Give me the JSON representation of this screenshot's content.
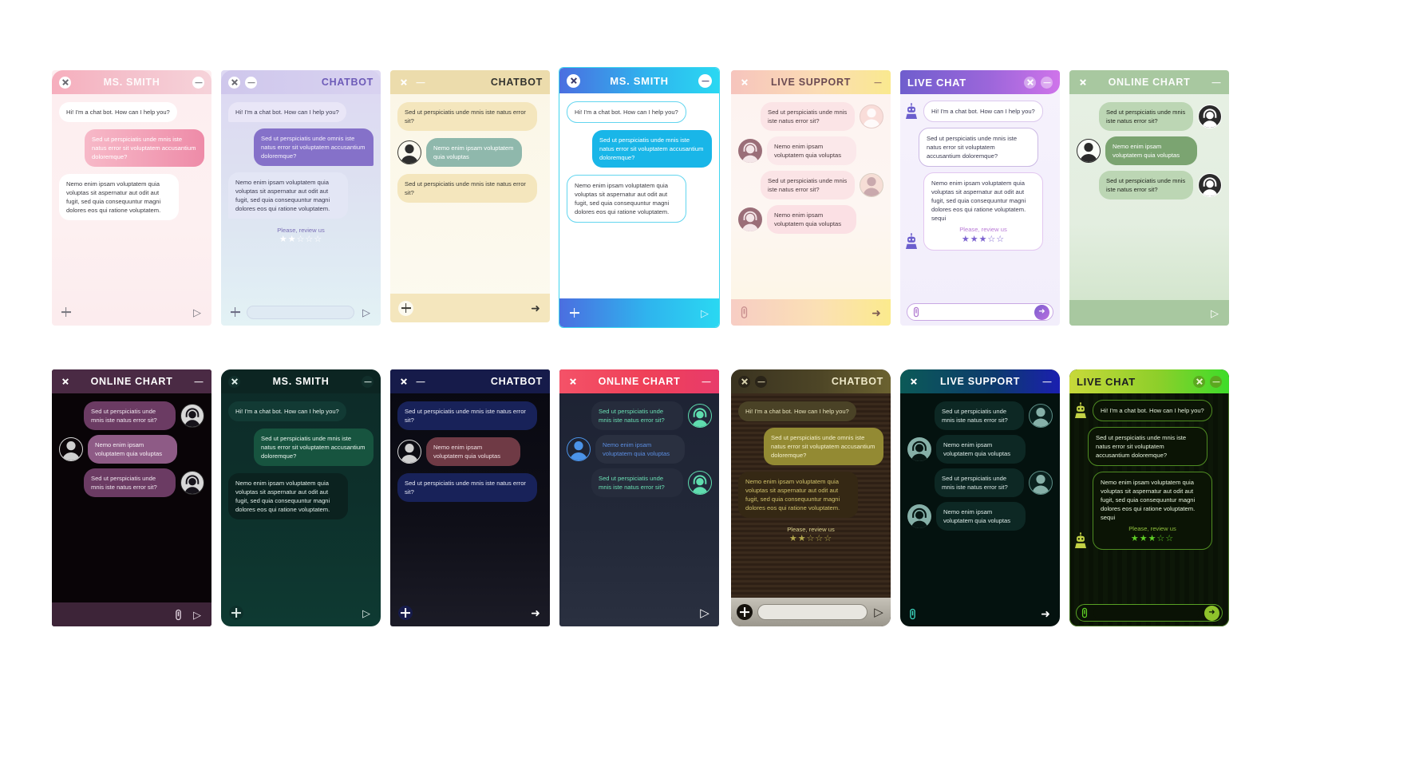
{
  "strings": {
    "greeting": "Hi! I'm a chat bot. How can I help you?",
    "q_long": "Sed ut perspiciatis unde mnis iste natus error sit voluptatem accusantium doloremque?",
    "q_long_omnis": "Sed ut perspiciatis unde omnis iste natus error sit voluptatem accusantium doloremque?",
    "answer_long": "Nemo enim ipsam voluptatem quia voluptas sit aspernatur aut odit aut fugit, sed quia consequuntur magni dolores eos qui ratione voluptatem.",
    "answer_long_sequi": "Nemo enim ipsam voluptatem quia voluptas sit aspernatur aut odit aut fugit, sed quia consequuntur magni dolores eos qui ratione voluptatem. sequi",
    "q_short": "Sed ut perspiciatis unde mnis iste natus error sit?",
    "answer_short": "Nemo enim ipsam voluptatem quia voluptas",
    "review": "Please, review us",
    "stars_2": "★★☆☆☆",
    "stars_3": "★★★☆☆"
  },
  "icons": {
    "close": "close-icon",
    "minimize": "minimize-icon",
    "send": "send-icon",
    "attach": "paperclip-icon",
    "plus": "plus-icon",
    "avatar": "avatar-icon",
    "headset": "headset-avatar-icon",
    "bot": "robot-icon"
  },
  "cards": [
    {
      "id": "card-1",
      "title": "MS. SMITH",
      "titleColor": "#ffffff",
      "theme": "pink-light",
      "messages": [
        {
          "side": "left",
          "text": "Hi! I'm a chat bot. How can I help you?"
        },
        {
          "side": "right",
          "text": "Sed ut perspiciatis unde mnis iste natus error sit voluptatem accusantium doloremque?"
        },
        {
          "side": "left",
          "text": "Nemo enim ipsam voluptatem quia voluptas sit aspernatur aut odit aut fugit, sed quia consequuntur magni dolores eos qui ratione voluptatem."
        }
      ],
      "footer": {
        "plus": true,
        "send": "triangle",
        "input": false
      }
    },
    {
      "id": "card-2",
      "title": "CHATBOT",
      "titleColor": "#6d5bb8",
      "theme": "lavender",
      "messages": [
        {
          "side": "left",
          "text": "Hi! I'm a chat bot. How can I help you?"
        },
        {
          "side": "right",
          "text": "Sed ut perspiciatis unde omnis iste natus error sit voluptatem accusantium doloremque?"
        },
        {
          "side": "left",
          "text": "Nemo enim ipsam voluptatem quia voluptas sit aspernatur aut odit aut fugit, sed quia consequuntur magni dolores eos qui ratione voluptatem."
        }
      ],
      "review": {
        "text": "Please, review us",
        "stars": "★★☆☆☆"
      },
      "footer": {
        "plus": true,
        "send": "triangle",
        "input": true
      }
    },
    {
      "id": "card-3",
      "title": "CHATBOT",
      "titleColor": "#3b3b3b",
      "theme": "cream",
      "messages": [
        {
          "side": "left",
          "text": "Sed ut perspiciatis unde mnis iste natus error sit?"
        },
        {
          "side": "right-av-left",
          "text": "Nemo enim ipsam voluptatem quia voluptas"
        },
        {
          "side": "left",
          "text": "Sed ut perspiciatis unde mnis iste natus error sit?"
        }
      ],
      "footer": {
        "plus": "round",
        "send": "arrow",
        "input": false
      }
    },
    {
      "id": "card-4",
      "title": "MS. SMITH",
      "titleColor": "#ffffff",
      "theme": "cyan-blue",
      "messages": [
        {
          "side": "left",
          "text": "Hi! I'm a chat bot. How can I help you?"
        },
        {
          "side": "right",
          "text": "Sed ut perspiciatis unde mnis iste natus error sit voluptatem accusantium doloremque?"
        },
        {
          "side": "left",
          "text": "Nemo enim ipsam voluptatem quia voluptas sit aspernatur aut odit aut fugit, sed quia consequuntur magni dolores eos qui ratione voluptatem."
        }
      ],
      "footer": {
        "plus": true,
        "send": "triangle",
        "input": false
      }
    },
    {
      "id": "card-5",
      "title": "LIVE SUPPORT",
      "titleColor": "#6b4a52",
      "theme": "peach-yellow",
      "messages": [
        {
          "side": "left-av-right",
          "text": "Sed ut perspiciatis unde mnis iste natus error sit?"
        },
        {
          "side": "right-av-left",
          "text": "Nemo enim ipsam voluptatem quia voluptas"
        },
        {
          "side": "left-av-right",
          "text": "Sed ut perspiciatis unde mnis iste natus error sit?"
        },
        {
          "side": "right-av-left",
          "text": "Nemo enim ipsam voluptatem quia voluptas"
        }
      ],
      "footer": {
        "clip": true,
        "send": "arrow",
        "input": false
      }
    },
    {
      "id": "card-6",
      "title": "LIVE CHAT",
      "titleColor": "#ffffff",
      "theme": "violet",
      "messages": [
        {
          "side": "left-bot",
          "text": "Hi! I'm a chat bot. How can I help you?"
        },
        {
          "side": "left",
          "text": "Sed ut perspiciatis unde mnis iste natus error sit voluptatem accusantium doloremque?"
        },
        {
          "side": "left-bot-review",
          "text": "Nemo enim ipsam voluptatem quia voluptas sit aspernatur aut odit aut fugit, sed quia consequuntur magni dolores eos qui ratione voluptatem. sequi"
        }
      ],
      "review": {
        "text": "Please, review us",
        "stars": "★★★☆☆"
      },
      "footer": {
        "clip": true,
        "send": "circle-arrow",
        "input": true
      }
    },
    {
      "id": "card-7",
      "title": "ONLINE CHART",
      "titleColor": "#ffffff",
      "theme": "green-soft",
      "messages": [
        {
          "side": "left-av-right",
          "text": "Sed ut perspiciatis unde mnis iste natus error sit?"
        },
        {
          "side": "right-av-left",
          "text": "Nemo enim ipsam voluptatem quia voluptas"
        },
        {
          "side": "left-av-right",
          "text": "Sed ut perspiciatis unde mnis iste natus error sit?"
        }
      ],
      "footer": {
        "send": "triangle",
        "input": false
      }
    },
    {
      "id": "card-8",
      "title": "ONLINE CHART",
      "titleColor": "#ffffff",
      "theme": "dark-plum",
      "messages": [
        {
          "side": "left-av-right",
          "text": "Sed ut perspiciatis unde mnis iste natus error sit?"
        },
        {
          "side": "right-av-left",
          "text": "Nemo enim ipsam voluptatem quia voluptas"
        },
        {
          "side": "left-av-right",
          "text": "Sed ut perspiciatis unde mnis iste natus error sit?"
        }
      ],
      "footer": {
        "clip": true,
        "send": "triangle",
        "input": false,
        "align": "right"
      }
    },
    {
      "id": "card-9",
      "title": "MS. SMITH",
      "titleColor": "#ffffff",
      "theme": "dark-teal",
      "messages": [
        {
          "side": "left",
          "text": "Hi! I'm a chat bot. How can I help you?"
        },
        {
          "side": "right",
          "text": "Sed ut perspiciatis unde mnis iste natus error sit voluptatem accusantium doloremque?"
        },
        {
          "side": "left",
          "text": "Nemo enim ipsam voluptatem quia voluptas sit aspernatur aut odit aut fugit, sed quia consequuntur magni dolores eos qui ratione voluptatem."
        }
      ],
      "footer": {
        "plus": "round",
        "send": "triangle",
        "input": false
      }
    },
    {
      "id": "card-10",
      "title": "CHATBOT",
      "titleColor": "#ffffff",
      "theme": "dark-navy",
      "messages": [
        {
          "side": "left",
          "text": "Sed ut perspiciatis unde mnis iste natus error sit?"
        },
        {
          "side": "right-av-left",
          "text": "Nemo enim ipsam voluptatem quia voluptas"
        },
        {
          "side": "left",
          "text": "Sed ut perspiciatis unde mnis iste natus error sit?"
        }
      ],
      "footer": {
        "plus": "round",
        "send": "arrow",
        "input": false
      }
    },
    {
      "id": "card-11",
      "title": "ONLINE CHART",
      "titleColor": "#ffffff",
      "theme": "dark-red",
      "messages": [
        {
          "side": "left-av-right",
          "text": "Sed ut perspiciatis unde mnis iste natus error sit?"
        },
        {
          "side": "right-av-left",
          "text": "Nemo enim ipsam voluptatem quia voluptas"
        },
        {
          "side": "left-av-right",
          "text": "Sed ut perspiciatis unde mnis iste natus error sit?"
        }
      ],
      "footer": {
        "send": "triangle",
        "input": false,
        "align": "right"
      }
    },
    {
      "id": "card-12",
      "title": "CHATBOT",
      "titleColor": "#efe9c8",
      "theme": "brown-olive",
      "messages": [
        {
          "side": "left",
          "text": "Hi! I'm a chat bot. How can I help you?"
        },
        {
          "side": "right",
          "text": "Sed ut perspiciatis unde omnis iste natus error sit voluptatem accusantium doloremque?"
        },
        {
          "side": "left",
          "text": "Nemo enim ipsam voluptatem quia voluptas sit aspernatur aut odit aut fugit, sed quia consequuntur magni dolores eos qui ratione voluptatem."
        }
      ],
      "review": {
        "text": "Please, review us",
        "stars": "★★☆☆☆"
      },
      "footer": {
        "plus": "round",
        "send": "triangle",
        "input": true,
        "skin": "metal"
      }
    },
    {
      "id": "card-13",
      "title": "LIVE SUPPORT",
      "titleColor": "#ffffff",
      "theme": "dark-blueteal",
      "messages": [
        {
          "side": "left-av-right",
          "text": "Sed ut perspiciatis unde mnis iste natus error sit?"
        },
        {
          "side": "right-av-left",
          "text": "Nemo enim ipsam voluptatem quia voluptas"
        },
        {
          "side": "left-av-right",
          "text": "Sed ut perspiciatis unde mnis iste natus error sit?"
        },
        {
          "side": "right-av-left",
          "text": "Nemo enim ipsam voluptatem quia voluptas"
        }
      ],
      "footer": {
        "clip": true,
        "send": "arrow",
        "input": false
      }
    },
    {
      "id": "card-14",
      "title": "LIVE CHAT",
      "titleColor": "#14200a",
      "theme": "neon-green",
      "messages": [
        {
          "side": "left-bot",
          "text": "Hi! I'm a chat bot. How can I help you?"
        },
        {
          "side": "left",
          "text": "Sed ut perspiciatis unde mnis iste natus error sit voluptatem accusantium doloremque?"
        },
        {
          "side": "left-bot-review",
          "text": "Nemo enim ipsam voluptatem quia voluptas sit aspernatur aut odit aut fugit, sed quia consequuntur magni dolores eos qui ratione voluptatem. sequi"
        }
      ],
      "review": {
        "text": "Please, review us",
        "stars": "★★★☆☆"
      },
      "footer": {
        "clip": true,
        "send": "circle-arrow",
        "input": true
      }
    }
  ]
}
